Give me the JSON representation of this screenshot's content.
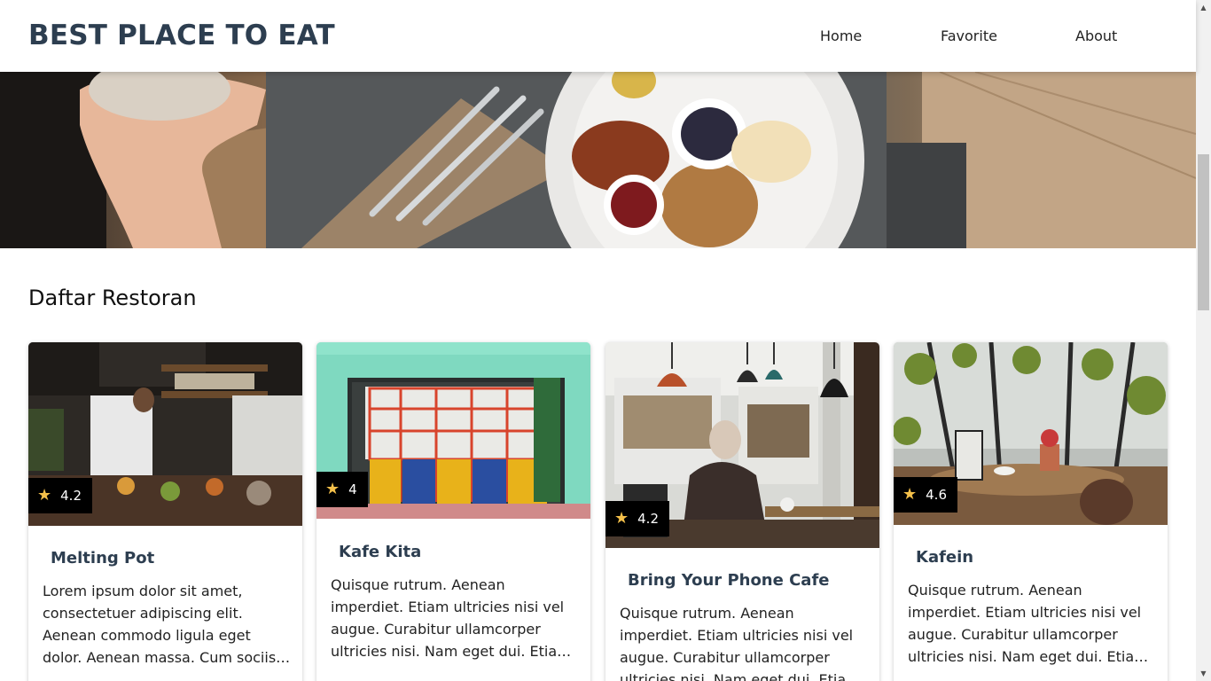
{
  "header": {
    "brand": "BEST PLACE TO EAT",
    "nav": [
      {
        "label": "Home"
      },
      {
        "label": "Favorite"
      },
      {
        "label": "About"
      }
    ]
  },
  "main": {
    "section_title": "Daftar Restoran",
    "restaurants": [
      {
        "name": "Melting Pot",
        "rating": "4.2",
        "description": "Lorem ipsum dolor sit amet, consectetuer adipiscing elit. Aenean commodo ligula eget dolor. Aenean massa. Cum sociis natoque penatibus et magnis dis parturient montes."
      },
      {
        "name": "Kafe Kita",
        "rating": "4",
        "description": "Quisque rutrum. Aenean imperdiet. Etiam ultricies nisi vel augue. Curabitur ullamcorper ultricies nisi. Nam eget dui. Etiam rhoncus. Maecenas tempus."
      },
      {
        "name": "Bring Your Phone Cafe",
        "rating": "4.2",
        "description": "Quisque rutrum. Aenean imperdiet. Etiam ultricies nisi vel augue. Curabitur ullamcorper ultricies nisi. Nam eget dui. Etiam rhoncus. Maecenas tempus."
      },
      {
        "name": "Kafein",
        "rating": "4.6",
        "description": "Quisque rutrum. Aenean imperdiet. Etiam ultricies nisi vel augue. Curabitur ullamcorper ultricies nisi. Nam eget dui. Etiam rhoncus. Maecenas tempus."
      }
    ]
  },
  "icons": {
    "rating": "star-icon",
    "scroll_up": "arrow-up-icon",
    "scroll_down": "arrow-down-icon"
  },
  "colors": {
    "brand": "#2d3e50",
    "rating_badge": "#000000",
    "star": "#f5c04a"
  }
}
